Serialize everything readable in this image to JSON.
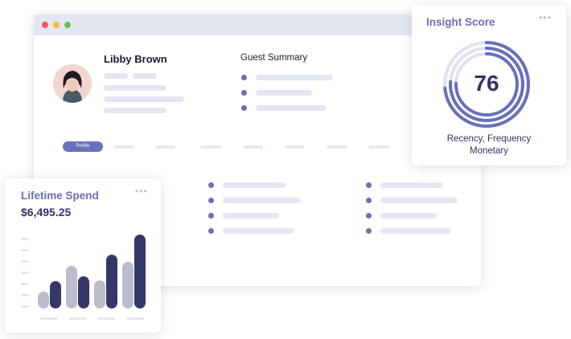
{
  "window": {
    "window_controls": [
      "close",
      "minimize",
      "maximize"
    ],
    "profile": {
      "name": "Libby Brown"
    },
    "summary": {
      "title": "Guest Summary"
    },
    "tabs": {
      "active_label": "Profile"
    }
  },
  "insight_card": {
    "title": "Insight Score",
    "score": "76",
    "subtitle_line1": "Recency, Frequency",
    "subtitle_line2": "Monetary",
    "menu_icon": "more-dots-icon"
  },
  "spend_card": {
    "title": "Lifetime Spend",
    "value": "$6,495.25",
    "menu_icon": "more-dots-icon"
  },
  "chart_data": {
    "type": "bar",
    "title": "Lifetime Spend",
    "xlabel": "",
    "ylabel": "",
    "ylim": [
      0,
      100
    ],
    "categories": [
      "",
      "",
      "",
      ""
    ],
    "series": [
      {
        "values": [
          22,
          55,
          36,
          60
        ],
        "color": "#bbbdcd"
      },
      {
        "values": [
          35,
          42,
          70,
          96
        ],
        "color": "#333867"
      }
    ]
  },
  "colors": {
    "accent": "#6870b8",
    "dark": "#333867",
    "light_bar": "#bbbdcd",
    "placeholder": "#e3e7f1"
  }
}
